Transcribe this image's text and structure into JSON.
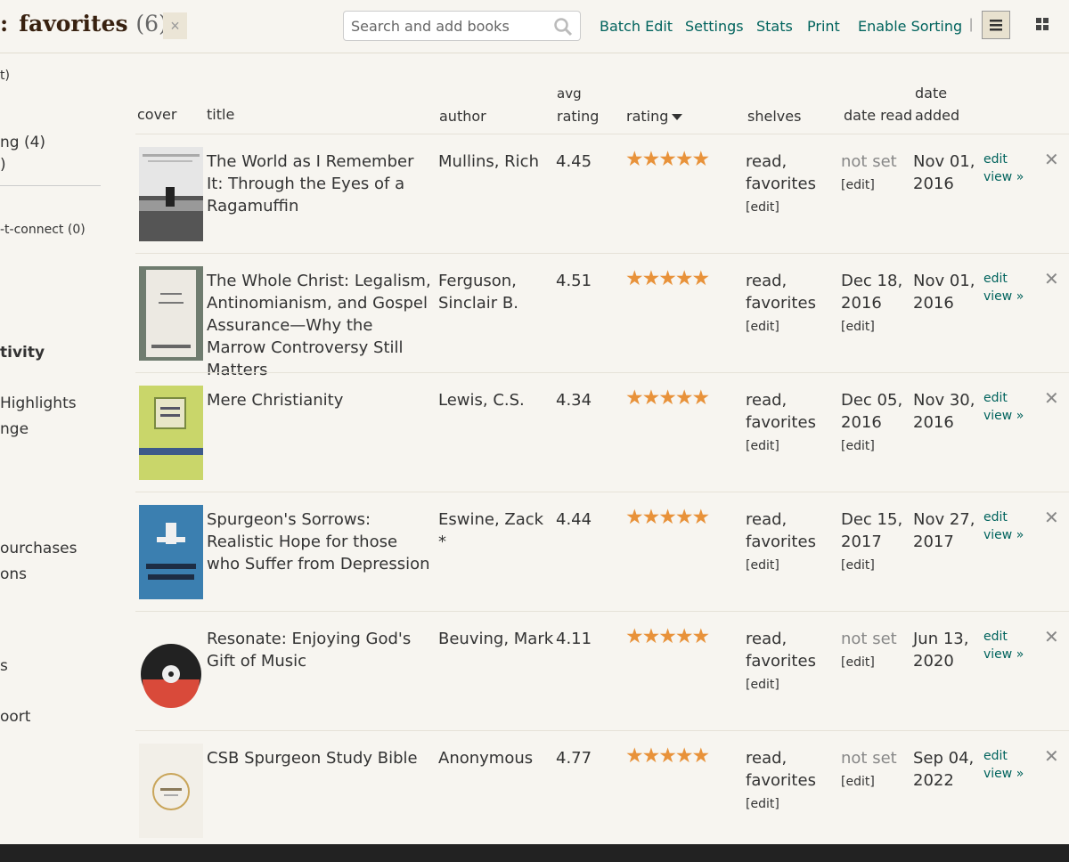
{
  "header": {
    "shelf_name": "favorites",
    "shelf_count": "(6)",
    "close_glyph": "×",
    "search_placeholder": "Search and add books",
    "links": [
      "Batch Edit",
      "Settings",
      "Stats",
      "Print",
      "Enable Sorting"
    ],
    "pipe": "|"
  },
  "sidebar": {
    "fragments": [
      "t)",
      "ng (4)",
      ")",
      "-t-connect (0)",
      "tivity",
      "Highlights",
      "nge",
      "ourchases",
      "ons",
      "s",
      "oort"
    ]
  },
  "table": {
    "headers": {
      "cover": "cover",
      "title": "title",
      "author": "author",
      "avg_rating_1": "avg",
      "avg_rating_2": "rating",
      "rating": "rating",
      "shelves": "shelves",
      "date_read": "date read",
      "date_added_1": "date",
      "date_added_2": "added"
    },
    "rows": [
      {
        "title": "The World as I Remember It: Through the Eyes of a Ragamuffin",
        "author": "Mullins, Rich",
        "avg_rating": "4.45",
        "stars": "★★★★★",
        "shelves_1": "read,",
        "shelves_2": "favorites",
        "shelves_edit": "[edit]",
        "date_read": "not set",
        "date_read_edit": "[edit]",
        "date_added_1": "Nov 01,",
        "date_added_2": "2016",
        "edit": "edit",
        "view": "view »",
        "remove": "✕"
      },
      {
        "title": "The Whole Christ: Legalism, Antinomianism, and Gospel Assurance—Why the Marrow Controversy Still Matters",
        "author": "Ferguson, Sinclair B.",
        "avg_rating": "4.51",
        "stars": "★★★★★",
        "shelves_1": "read,",
        "shelves_2": "favorites",
        "shelves_edit": "[edit]",
        "date_read_1": "Dec 18,",
        "date_read_2": "2016",
        "date_read_edit": "[edit]",
        "date_added_1": "Nov 01,",
        "date_added_2": "2016",
        "edit": "edit",
        "view": "view »",
        "remove": "✕"
      },
      {
        "title": "Mere Christianity",
        "author": "Lewis, C.S.",
        "avg_rating": "4.34",
        "stars": "★★★★★",
        "shelves_1": "read,",
        "shelves_2": "favorites",
        "shelves_edit": "[edit]",
        "date_read_1": "Dec 05,",
        "date_read_2": "2016",
        "date_read_edit": "[edit]",
        "date_added_1": "Nov 30,",
        "date_added_2": "2016",
        "edit": "edit",
        "view": "view »",
        "remove": "✕"
      },
      {
        "title": "Spurgeon's Sorrows: Realistic Hope for those who Suffer from Depression",
        "author": "Eswine, Zack *",
        "avg_rating": "4.44",
        "stars": "★★★★★",
        "shelves_1": "read,",
        "shelves_2": "favorites",
        "shelves_edit": "[edit]",
        "date_read_1": "Dec 15,",
        "date_read_2": "2017",
        "date_read_edit": "[edit]",
        "date_added_1": "Nov 27,",
        "date_added_2": "2017",
        "edit": "edit",
        "view": "view »",
        "remove": "✕"
      },
      {
        "title": "Resonate: Enjoying God's Gift of Music",
        "author": "Beuving, Mark",
        "avg_rating": "4.11",
        "stars": "★★★★★",
        "shelves_1": "read,",
        "shelves_2": "favorites",
        "shelves_edit": "[edit]",
        "date_read": "not set",
        "date_read_edit": "[edit]",
        "date_added_1": "Jun 13,",
        "date_added_2": "2020",
        "edit": "edit",
        "view": "view »",
        "remove": "✕"
      },
      {
        "title": "CSB Spurgeon Study Bible",
        "author": "Anonymous",
        "avg_rating": "4.77",
        "stars": "★★★★★",
        "shelves_1": "read,",
        "shelves_2": "favorites",
        "shelves_edit": "[edit]",
        "date_read": "not set",
        "date_read_edit": "[edit]",
        "date_added_1": "Sep 04,",
        "date_added_2": "2022",
        "edit": "edit",
        "view": "view »",
        "remove": "✕"
      }
    ]
  },
  "colors": {
    "link": "#00635d",
    "star": "#e8923a",
    "title_brown": "#382110"
  }
}
